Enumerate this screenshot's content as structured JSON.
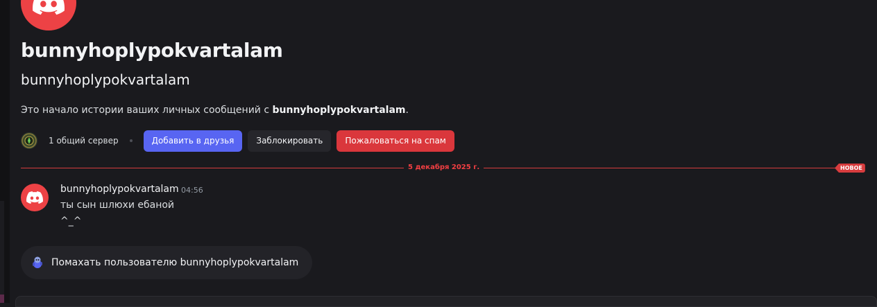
{
  "profile": {
    "display_name": "bunnyhoplypokvartalam",
    "username": "bunnyhoplypokvartalam",
    "intro_prefix": "Это начало истории ваших личных сообщений с ",
    "intro_name": "bunnyhoplypokvartalam",
    "intro_suffix": ".",
    "avatar_icon": "discord-logo-icon"
  },
  "actions": {
    "mutual_servers": "1 общий сервер",
    "add_friend": "Добавить в друзья",
    "block": "Заблокировать",
    "report_spam": "Пожаловаться на спам"
  },
  "divider": {
    "date": "5 декабря 2025 г.",
    "new_badge": "НОВОЕ"
  },
  "message": {
    "author": "bunnyhoplypokvartalam",
    "time": "04:56",
    "lines": [
      "ты сын шлюхи ебаной",
      "^_^"
    ]
  },
  "wave": {
    "label": "Помахать пользователю bunnyhoplypokvartalam"
  },
  "colors": {
    "background": "#1a1a1e",
    "avatar": "#ed4245",
    "primary": "#5865f2",
    "danger": "#da373c",
    "new_divider": "#d83c3e"
  }
}
